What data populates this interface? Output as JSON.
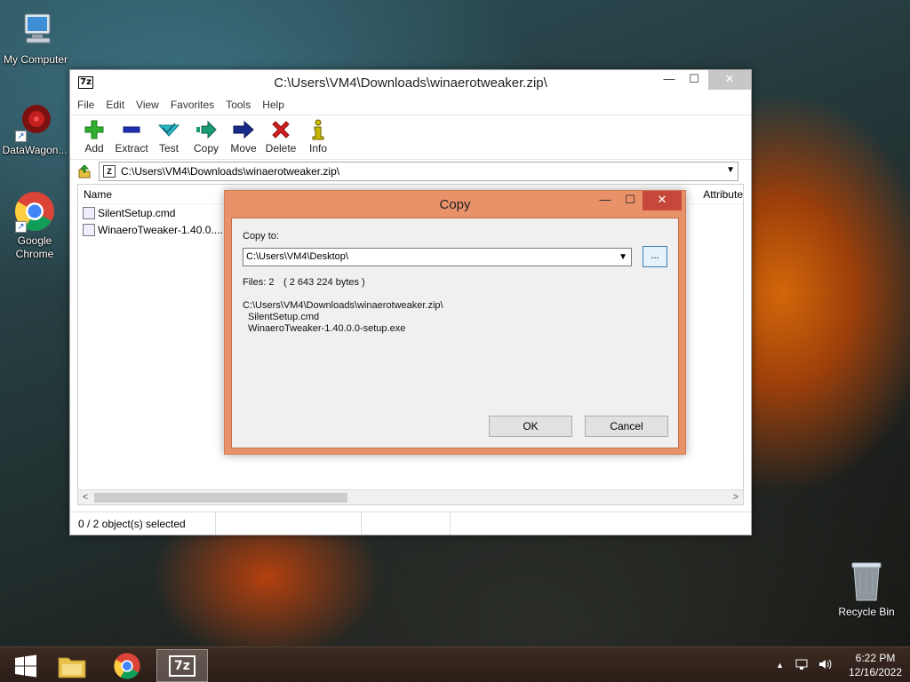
{
  "desktop": {
    "icons": [
      {
        "label": "My Computer"
      },
      {
        "label": "DataWagon..."
      },
      {
        "label": "Google Chrome"
      },
      {
        "label": "Recycle Bin"
      }
    ]
  },
  "window": {
    "title": "C:\\Users\\VM4\\Downloads\\winaerotweaker.zip\\",
    "app_icon": "7z",
    "menu": [
      "File",
      "Edit",
      "View",
      "Favorites",
      "Tools",
      "Help"
    ],
    "toolbar": [
      {
        "label": "Add",
        "icon": "plus-icon",
        "color": "#2fae2f"
      },
      {
        "label": "Extract",
        "icon": "minus-icon",
        "color": "#1f2fb4"
      },
      {
        "label": "Test",
        "icon": "check-icon",
        "color": "#28b6c6"
      },
      {
        "label": "Copy",
        "icon": "copy-arrow-icon",
        "color": "#1a9a76"
      },
      {
        "label": "Move",
        "icon": "move-arrow-icon",
        "color": "#1a2a8a"
      },
      {
        "label": "Delete",
        "icon": "x-icon",
        "color": "#d21f1f"
      },
      {
        "label": "Info",
        "icon": "info-icon",
        "color": "#c9b800"
      }
    ],
    "address": "C:\\Users\\VM4\\Downloads\\winaerotweaker.zip\\",
    "columns": {
      "name": "Name",
      "attributes": "Attribute"
    },
    "files": [
      {
        "name": "SilentSetup.cmd"
      },
      {
        "name": "WinaeroTweaker-1.40.0...."
      }
    ],
    "status": "0 / 2 object(s) selected"
  },
  "dialog": {
    "title": "Copy",
    "copy_to_label": "Copy to:",
    "destination": "C:\\Users\\VM4\\Desktop\\",
    "browse_label": "...",
    "files_count": "Files: 2",
    "files_bytes": "( 2 643 224 bytes )",
    "source_path": "C:\\Users\\VM4\\Downloads\\winaerotweaker.zip\\",
    "source_items": [
      "SilentSetup.cmd",
      "WinaeroTweaker-1.40.0.0-setup.exe"
    ],
    "ok_label": "OK",
    "cancel_label": "Cancel",
    "accent": "#e9926a"
  },
  "taskbar": {
    "time": "6:22 PM",
    "date": "12/16/2022",
    "active_app_label": "7z"
  }
}
